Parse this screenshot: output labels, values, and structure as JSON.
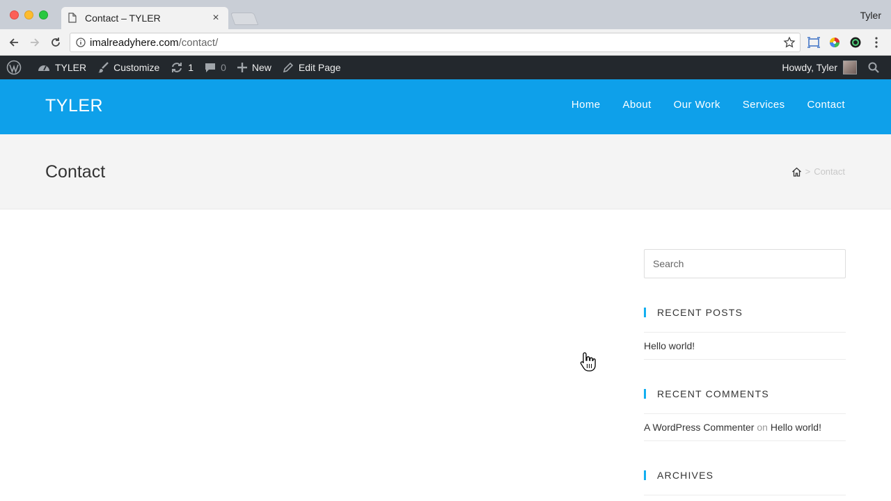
{
  "browser": {
    "tab_title": "Contact – TYLER",
    "tab_close": "×",
    "profile_name": "Tyler",
    "url_host": "imalreadyhere.com",
    "url_path": "/contact/"
  },
  "adminbar": {
    "site_name": "TYLER",
    "customize": "Customize",
    "updates_count": "1",
    "comments_count": "0",
    "new_label": "New",
    "edit_page": "Edit Page",
    "howdy": "Howdy, Tyler"
  },
  "site": {
    "logo": "TYLER",
    "nav": [
      "Home",
      "About",
      "Our Work",
      "Services",
      "Contact"
    ]
  },
  "page": {
    "title": "Contact",
    "breadcrumb_separator": ">",
    "breadcrumb_current": "Contact"
  },
  "sidebar": {
    "search_placeholder": "Search",
    "recent_posts_title": "RECENT POSTS",
    "recent_posts": [
      "Hello world!"
    ],
    "recent_comments_title": "RECENT COMMENTS",
    "comment_author": "A WordPress Commenter",
    "comment_on": "on",
    "comment_post": "Hello world!",
    "archives_title": "ARCHIVES"
  },
  "colors": {
    "header_blue": "#0ea0ea",
    "accent": "#13aff0",
    "adminbar": "#23282d"
  }
}
